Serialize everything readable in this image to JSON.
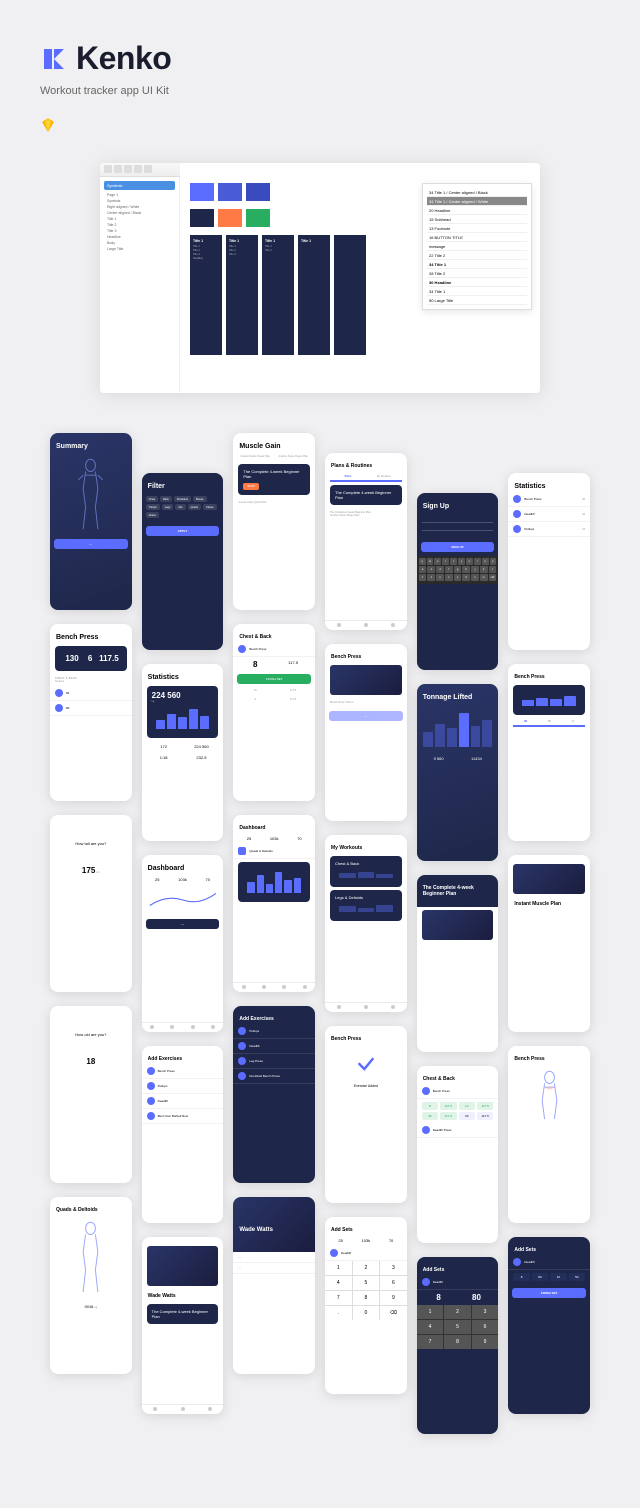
{
  "brand": {
    "name": "Kenko",
    "subtitle": "Workout tracker app UI Kit"
  },
  "sketch": {
    "sidebar_header": "Symbols",
    "sidebar_items": [
      "Page 1",
      "Symbols",
      "Right aligned / White",
      "Center aligned / Black",
      "Title 1",
      "Title 2",
      "Title 3",
      "Headline",
      "Body",
      "Large Title"
    ],
    "type_col_title": "Title 1",
    "type_col_items": [
      "Title 1",
      "Title 2",
      "Title 3",
      "Headline"
    ],
    "panel": [
      "34 Title 1 / Center aligned / Black",
      "34 Title 1 / Center aligned / White",
      "20 Headline",
      "15 Subhead",
      "13 Footnote",
      "16 BUTTON TITLE",
      "message",
      "22 Title 2",
      "34 Title 1",
      "28 Title 2",
      "30 Headline",
      "34 Title 1",
      "50 Large Title"
    ]
  },
  "screens": {
    "summary": {
      "title": "Summary"
    },
    "filter": {
      "title": "Filter",
      "chips": [
        "Chest",
        "Back",
        "Shoulders",
        "Biceps",
        "Triceps",
        "Legs",
        "Abs",
        "Quads",
        "Calves",
        "Glutes",
        "Hamstrings"
      ],
      "apply": "APPLY"
    },
    "muscle_gain": {
      "title": "Muscle Gain",
      "card1": "Instant Muscle Power Plan",
      "card2": "Another Super Duper Plan",
      "feature": "The Complete 4-week Beginner Plan",
      "cta": "START",
      "card3": "4-week Crazy Quick Plan"
    },
    "plans": {
      "title": "Plans & Routines",
      "tabs": [
        "Plans",
        "My Routines"
      ],
      "feature": "The Complete 4-week Beginner Plan",
      "sub": "The Complete 8-week Beginner Plan",
      "sub2": "Another Super Duper Plan"
    },
    "signup": {
      "title": "Sign Up",
      "cta": "SIGN UP"
    },
    "bench_press": {
      "title": "Bench Press",
      "reps": "130",
      "sets": "6",
      "weight": "117.5",
      "section": "Chest & Back",
      "sub": "Series 2"
    },
    "statistics": {
      "title": "Statistics",
      "big": "224 560",
      "unit": "kg",
      "s1": "172",
      "s2": "224 560",
      "s3": "1:18",
      "s4": "232.5"
    },
    "chest_back": {
      "title": "Chest & Back",
      "ex": "Bench Press",
      "n1": "8",
      "n2": "117.5",
      "n3": "10",
      "n4": "117.5",
      "n5": "6",
      "n6": "117.5",
      "btn": "FINISH SET"
    },
    "bench_video": {
      "title": "Bench Press",
      "caption": "Bench Press: How to"
    },
    "tonnage": {
      "title": "Tonnage Lifted",
      "v1": "9 560",
      "v2": "11434"
    },
    "height": {
      "q": "How tall are you?",
      "val": "175",
      "unit": "cm"
    },
    "dashboard": {
      "title": "Dashboard",
      "s1": "25",
      "s2": "103k",
      "s3": "70",
      "card": "Quads & Deltoids"
    },
    "age": {
      "q": "How old are you?",
      "val": "18"
    },
    "add_ex": {
      "title": "Add Exercises",
      "items": [
        "Bench Press",
        "Pullups",
        "Deadlift",
        "Bent Over Barbell Row",
        "Leg Press",
        "Dumbbell Bench Press"
      ]
    },
    "my_workouts": {
      "title": "My Workouts",
      "w1": "Chest & Back",
      "w2": "Legs & Deltoids"
    },
    "plan_detail": {
      "title": "The Complete 4-week Beginner Plan"
    },
    "instant_plan": {
      "title": "Instant Muscle Plan"
    },
    "quads": {
      "title": "Quads & Deltoids",
      "v1": "9016",
      "v2": "kg"
    },
    "wade": {
      "name": "Wade Watts",
      "plan": "The Complete 4-week Beginner Plan"
    },
    "ex_added": {
      "msg": "Exercise Added"
    },
    "chest_back2": {
      "title": "Chest & Back",
      "ex1": "Bench Press",
      "ex2": "Deadlift Press",
      "w": "117.5"
    },
    "add_sets": {
      "title": "Add Sets",
      "vals": [
        "25",
        "103k",
        "70"
      ],
      "ex": "Deadlift",
      "n1": "8",
      "n2": "80",
      "btn": "FINISH SET"
    },
    "bench_anatomy": {
      "title": "Bench Press"
    }
  }
}
